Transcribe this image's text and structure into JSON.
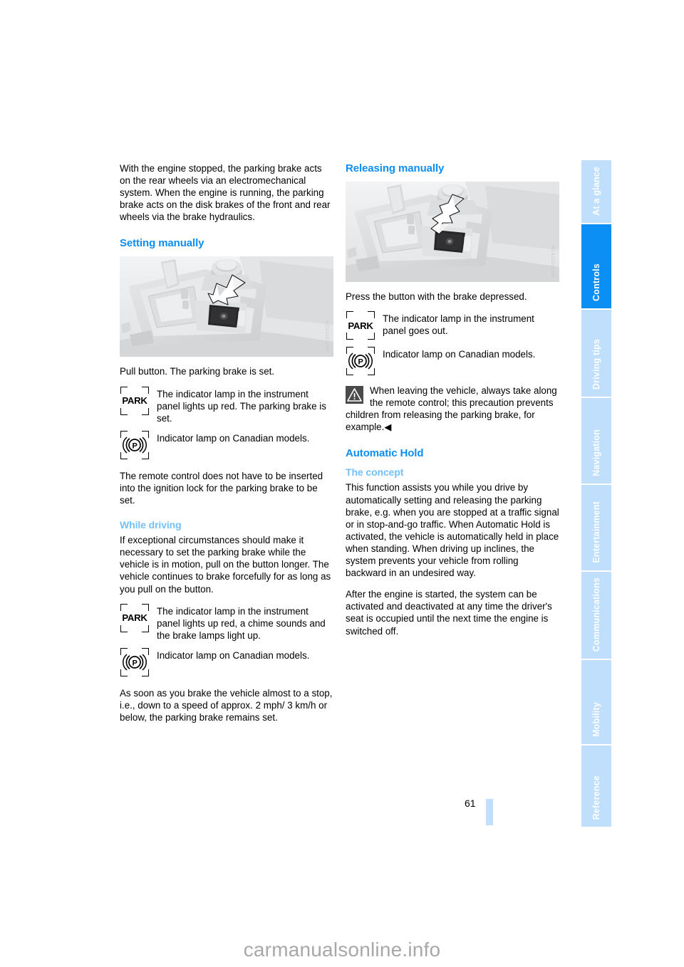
{
  "document": {
    "page_number": "61",
    "watermark": "carmanualsonline.info"
  },
  "side_rail": {
    "tabs": [
      {
        "label": "At a glance",
        "active": false
      },
      {
        "label": "Controls",
        "active": true
      },
      {
        "label": "Driving tips",
        "active": false
      },
      {
        "label": "Navigation",
        "active": false
      },
      {
        "label": "Entertainment",
        "active": false
      },
      {
        "label": "Communications",
        "active": false
      },
      {
        "label": "Mobility",
        "active": false
      },
      {
        "label": "Reference",
        "active": false
      }
    ],
    "active_color": "#0b8ff5",
    "inactive_color": "#bfdffc"
  },
  "left_column": {
    "intro": "With the engine stopped, the parking brake acts on the rear wheels via an electromechanical system. When the engine is running, the parking brake acts on the disk brakes of the front and rear wheels via the brake hydraulics.",
    "setting_manually_heading": "Setting manually",
    "photo_watermark": "WCA1021CMS",
    "pull_button_text": "Pull button. The parking brake is set.",
    "symbol_park_1": {
      "glyph": "PARK",
      "text": "The indicator lamp in the instrument panel lights up red. The parking brake is set."
    },
    "symbol_canada_1": {
      "glyph": "brake-p-icon",
      "text": "Indicator lamp on Canadian models."
    },
    "remote_control_text": "The remote control does not have to be inserted into the ignition lock for the parking brake to be set.",
    "while_driving_subheading": "While driving",
    "while_driving_text": "If exceptional circumstances should make it necessary to set the parking brake while the vehicle is in motion, pull on the button longer. The vehicle continues to brake forcefully for as long as you pull on the button.",
    "symbol_park_2": {
      "glyph": "PARK",
      "text": "The indicator lamp in the instrument panel lights up red, a chime sounds and the brake lamps light up."
    },
    "symbol_canada_2": {
      "glyph": "brake-p-icon",
      "text": "Indicator lamp on Canadian models."
    },
    "closing_text": "As soon as you brake the vehicle almost to a stop, i.e., down to a speed of approx. 2 mph/ 3 km/h or below, the parking brake remains set."
  },
  "right_column": {
    "releasing_manually_heading": "Releasing manually",
    "photo_watermark": "WCA1022CMS",
    "press_button_text": "Press the button with the brake depressed.",
    "symbol_park_3": {
      "glyph": "PARK",
      "text": "The indicator lamp  in the instrument panel goes out."
    },
    "symbol_canada_3": {
      "glyph": "brake-p-icon",
      "text": "Indicator lamp on Canadian models."
    },
    "warning": {
      "icon": "warning-triangle-icon",
      "text": "When leaving the vehicle, always take along the remote control; this precaution prevents children from releasing the parking brake, for example.",
      "end_marker": "◀"
    },
    "automatic_hold_heading": "Automatic Hold",
    "the_concept_subheading": "The concept",
    "concept_paragraph_1": "This function assists you while you drive by automatically setting and releasing the parking brake, e.g. when you are stopped at a traffic signal or in stop-and-go traffic. When Automatic Hold is activated, the vehicle is automatically held in place when standing. When driving up inclines, the system prevents your vehicle from rolling backward in an undesired way.",
    "concept_paragraph_2": "After the engine is started, the system can be activated and deactivated at any time the driver's seat is occupied until the next time the engine is switched off."
  },
  "colors": {
    "heading_blue": "#0d8ef5",
    "subheading_blue": "#73c0f7",
    "rail_active": "#0b8ff5",
    "rail_inactive": "#bfdffc",
    "warning_icon_bg": "#4a4a4a"
  }
}
